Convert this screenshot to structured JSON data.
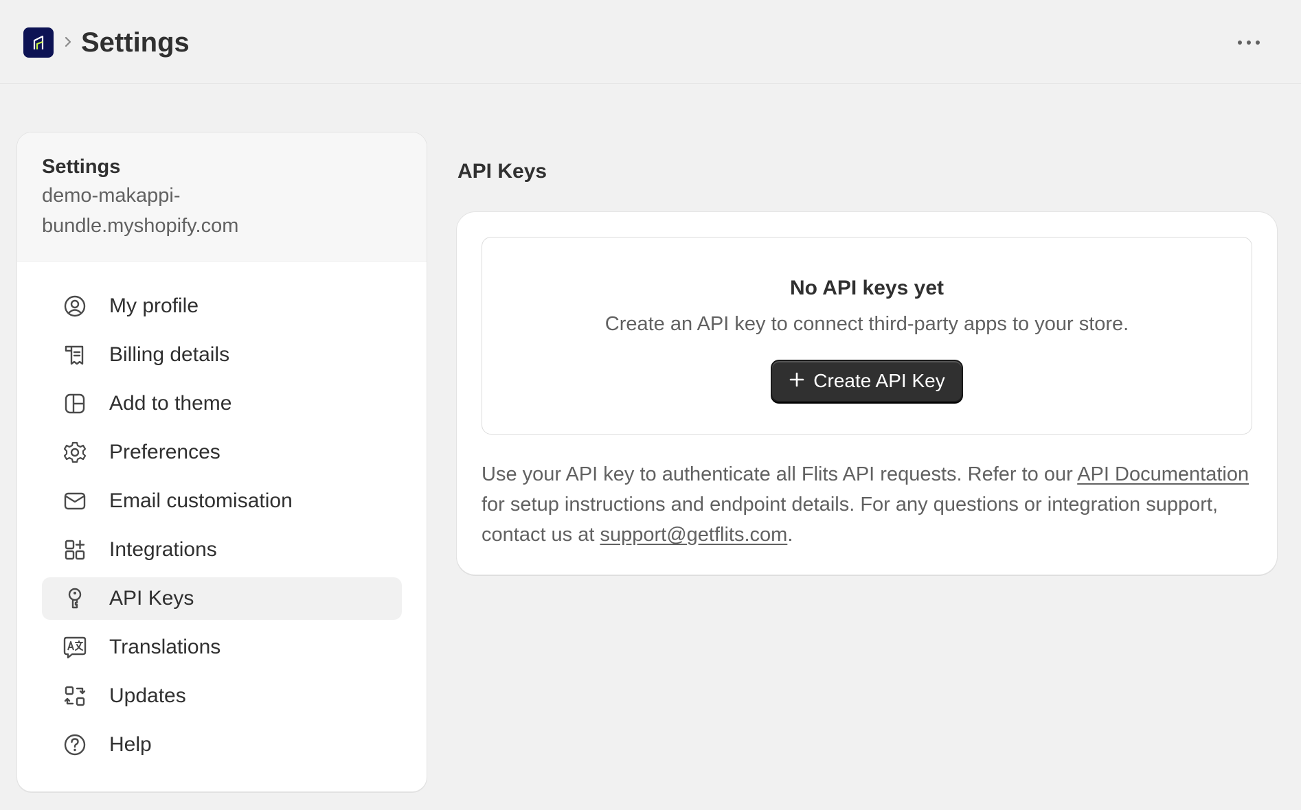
{
  "header": {
    "title": "Settings",
    "logo_icon": "app-logo-icon",
    "more_icon": "more-horizontal-icon"
  },
  "sidebar": {
    "title": "Settings",
    "domain": "demo-makappi-bundle.myshopify.com",
    "items": [
      {
        "label": "My profile",
        "icon": "user-circle-icon"
      },
      {
        "label": "Billing details",
        "icon": "receipt-icon"
      },
      {
        "label": "Add to theme",
        "icon": "layout-icon"
      },
      {
        "label": "Preferences",
        "icon": "gear-icon"
      },
      {
        "label": "Email customisation",
        "icon": "envelope-icon"
      },
      {
        "label": "Integrations",
        "icon": "apps-plus-icon"
      },
      {
        "label": "API Keys",
        "icon": "key-icon",
        "active": true
      },
      {
        "label": "Translations",
        "icon": "translate-icon"
      },
      {
        "label": "Updates",
        "icon": "refresh-apps-icon"
      },
      {
        "label": "Help",
        "icon": "question-circle-icon"
      }
    ]
  },
  "main": {
    "section_title": "API Keys",
    "empty_state": {
      "title": "No API keys yet",
      "description": "Create an API key to connect third-party apps to your store.",
      "button_label": "Create API Key"
    },
    "help": {
      "text_1": "Use your API key to authenticate all Flits API requests. Refer to our ",
      "link_docs": "API Documentation",
      "text_2": " for setup instructions and endpoint details. For any questions or integration support, contact us at ",
      "link_email": "support@getflits.com",
      "text_3": "."
    }
  },
  "colors": {
    "background": "#f1f1f1",
    "card": "#ffffff",
    "primary_button": "#303030",
    "logo_bg": "#0d1354",
    "logo_accent": "#c8f542"
  }
}
